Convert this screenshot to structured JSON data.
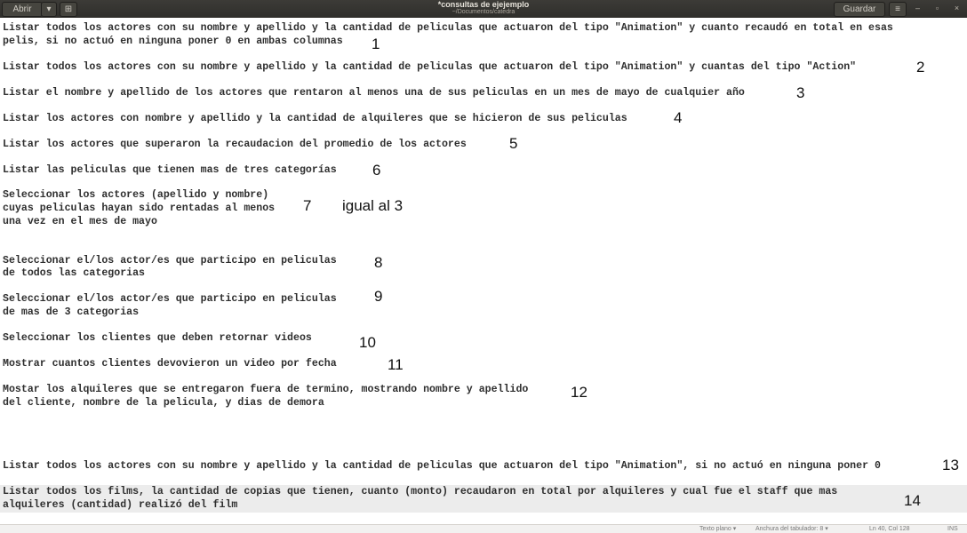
{
  "window": {
    "title": "*consultas de ejejemplo",
    "subtitle": "~/Documentos/catedra",
    "open_label": "Abrir",
    "save_label": "Guardar"
  },
  "editor": {
    "blocks": [
      {
        "lines": [
          "Listar todos los actores con su nombre y apellido y la cantidad de peliculas que actuaron del tipo \"Animation\" y cuanto recaudó en total en esas",
          "pelis, si no actuó en ninguna poner 0 en ambas columnas"
        ],
        "number": "1"
      },
      {
        "lines": [
          "Listar todos los actores con su nombre y apellido y la cantidad de peliculas que actuaron del tipo \"Animation\" y cuantas del tipo \"Action\""
        ],
        "number": "2"
      },
      {
        "lines": [
          "Listar el nombre y apellido de los actores que rentaron al menos una de sus peliculas en un mes de mayo de cualquier año"
        ],
        "number": "3"
      },
      {
        "lines": [
          "Listar los actores con nombre y apellido y la cantidad de alquileres que se hicieron de sus peliculas"
        ],
        "number": "4"
      },
      {
        "lines": [
          "Listar los actores que superaron la recaudacion del promedio de los actores"
        ],
        "number": "5"
      },
      {
        "lines": [
          "Listar las peliculas que tienen mas de tres categorías"
        ],
        "number": "6"
      },
      {
        "lines": [
          "Seleccionar los actores (apellido y nombre)",
          "cuyas peliculas hayan sido rentadas al menos",
          "una vez en el mes de mayo"
        ],
        "number": "7",
        "note": "igual al 3"
      },
      {
        "lines": [
          "Seleccionar el/los actor/es que participo en peliculas",
          "de todos las categorias"
        ],
        "number": "8"
      },
      {
        "lines": [
          "Seleccionar el/los actor/es que participo en peliculas",
          "de mas de 3 categorias"
        ],
        "number": "9"
      },
      {
        "lines": [
          "Seleccionar los clientes que deben retornar videos"
        ],
        "number": "10"
      },
      {
        "lines": [
          "Mostrar cuantos clientes devovieron un video por fecha"
        ],
        "number": "11"
      },
      {
        "lines": [
          "Mostar los alquileres que se entregaron fuera de termino, mostrando nombre y apellido",
          "del cliente, nombre de la pelicula, y dias de demora"
        ],
        "number": "12"
      },
      {
        "lines": [
          "Listar todos los actores con su nombre y apellido y la cantidad de peliculas que actuaron del tipo \"Animation\", si no actuó en ninguna poner 0"
        ],
        "number": "13"
      },
      {
        "lines": [
          "Listar todos los films, la cantidad de copias que tienen, cuanto (monto) recaudaron en total por alquileres y cual fue el staff que mas",
          "alquileres (cantidad) realizó del film"
        ],
        "number": "14"
      }
    ]
  },
  "statusbar": {
    "language": "Texto plano",
    "tab_width": "Anchura del tabulador: 8",
    "position": "Ln 40, Col 128",
    "mode": "INS"
  }
}
